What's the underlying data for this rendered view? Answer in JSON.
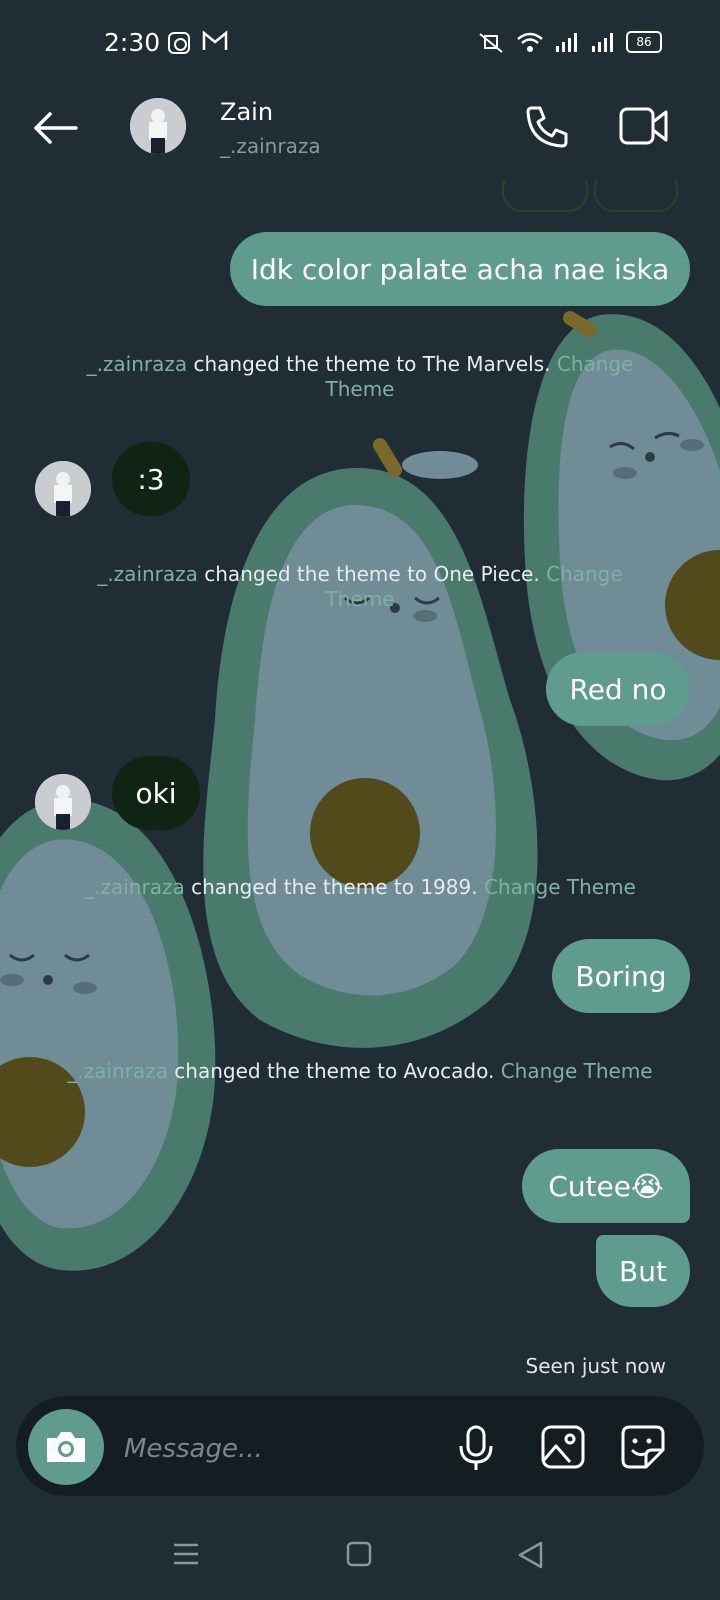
{
  "status": {
    "time": "2:30",
    "battery": "86"
  },
  "header": {
    "name": "Zain",
    "handle": "_.zainraza"
  },
  "messages": {
    "m1": "Idk color palate acha nae iska",
    "m2": ":3",
    "m3": "Red no",
    "m4": "oki",
    "m5": "Boring",
    "m6": "Cutee😭",
    "m7": "But"
  },
  "system": {
    "s1": {
      "user": "_.zainraza",
      "text": " changed the theme to The Marvels. ",
      "link": "Change Theme"
    },
    "s2": {
      "user": "_.zainraza",
      "text": " changed the theme to One Piece. ",
      "link": "Change Theme"
    },
    "s3": {
      "user": "_.zainraza",
      "text": " changed the theme to 1989. ",
      "link": "Change Theme"
    },
    "s4": {
      "user": "_.zainraza",
      "text": " changed the theme to Avocado. ",
      "link": "Change Theme"
    }
  },
  "seen": "Seen just now",
  "composer": {
    "placeholder": "Message..."
  },
  "colors": {
    "background": "#212d35",
    "bubble_out": "#5f9c8d",
    "bubble_in": "#0f2412",
    "accent": "#7fb1a3"
  },
  "icons": [
    "back-arrow-icon",
    "phone-icon",
    "video-icon",
    "camera-icon",
    "microphone-icon",
    "gallery-icon",
    "sticker-icon",
    "menu-icon",
    "home-icon",
    "back-triangle-icon"
  ]
}
